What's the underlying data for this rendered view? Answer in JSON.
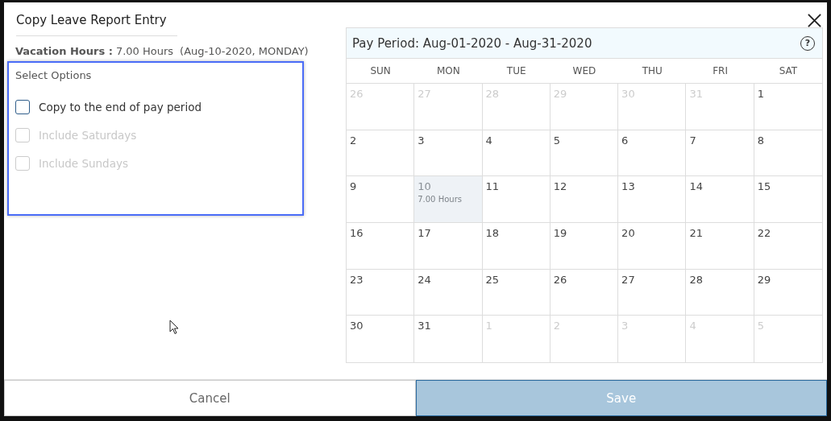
{
  "dialog": {
    "title": "Copy Leave Report Entry"
  },
  "entry": {
    "label": "Vacation Hours :",
    "hours": "7.00 Hours",
    "date": "(Aug-10-2020, MONDAY)"
  },
  "options": {
    "heading": "Select Options",
    "focused": true,
    "items": [
      {
        "label": "Copy to the end of pay period",
        "checked": false,
        "disabled": false
      },
      {
        "label": "Include Saturdays",
        "checked": false,
        "disabled": true
      },
      {
        "label": "Include Sundays",
        "checked": false,
        "disabled": true
      }
    ]
  },
  "calendar": {
    "title": "Pay Period: Aug-01-2020 - Aug-31-2020",
    "help": "?",
    "weekdays": [
      "SUN",
      "MON",
      "TUE",
      "WED",
      "THU",
      "FRI",
      "SAT"
    ],
    "days": [
      {
        "day": "26",
        "outside": true,
        "selected": false
      },
      {
        "day": "27",
        "outside": true,
        "selected": false
      },
      {
        "day": "28",
        "outside": true,
        "selected": false
      },
      {
        "day": "29",
        "outside": true,
        "selected": false
      },
      {
        "day": "30",
        "outside": true,
        "selected": false
      },
      {
        "day": "31",
        "outside": true,
        "selected": false
      },
      {
        "day": "1",
        "outside": false,
        "selected": false
      },
      {
        "day": "2",
        "outside": false,
        "selected": false
      },
      {
        "day": "3",
        "outside": false,
        "selected": false
      },
      {
        "day": "4",
        "outside": false,
        "selected": false
      },
      {
        "day": "5",
        "outside": false,
        "selected": false
      },
      {
        "day": "6",
        "outside": false,
        "selected": false
      },
      {
        "day": "7",
        "outside": false,
        "selected": false
      },
      {
        "day": "8",
        "outside": false,
        "selected": false
      },
      {
        "day": "9",
        "outside": false,
        "selected": false
      },
      {
        "day": "10",
        "outside": false,
        "selected": true,
        "note": "7.00 Hours"
      },
      {
        "day": "11",
        "outside": false,
        "selected": false
      },
      {
        "day": "12",
        "outside": false,
        "selected": false
      },
      {
        "day": "13",
        "outside": false,
        "selected": false
      },
      {
        "day": "14",
        "outside": false,
        "selected": false
      },
      {
        "day": "15",
        "outside": false,
        "selected": false
      },
      {
        "day": "16",
        "outside": false,
        "selected": false
      },
      {
        "day": "17",
        "outside": false,
        "selected": false
      },
      {
        "day": "18",
        "outside": false,
        "selected": false
      },
      {
        "day": "19",
        "outside": false,
        "selected": false
      },
      {
        "day": "20",
        "outside": false,
        "selected": false
      },
      {
        "day": "21",
        "outside": false,
        "selected": false
      },
      {
        "day": "22",
        "outside": false,
        "selected": false
      },
      {
        "day": "23",
        "outside": false,
        "selected": false
      },
      {
        "day": "24",
        "outside": false,
        "selected": false
      },
      {
        "day": "25",
        "outside": false,
        "selected": false
      },
      {
        "day": "26",
        "outside": false,
        "selected": false
      },
      {
        "day": "27",
        "outside": false,
        "selected": false
      },
      {
        "day": "28",
        "outside": false,
        "selected": false
      },
      {
        "day": "29",
        "outside": false,
        "selected": false
      },
      {
        "day": "30",
        "outside": false,
        "selected": false
      },
      {
        "day": "31",
        "outside": false,
        "selected": false
      },
      {
        "day": "1",
        "outside": true,
        "selected": false
      },
      {
        "day": "2",
        "outside": true,
        "selected": false
      },
      {
        "day": "3",
        "outside": true,
        "selected": false
      },
      {
        "day": "4",
        "outside": true,
        "selected": false
      },
      {
        "day": "5",
        "outside": true,
        "selected": false
      }
    ]
  },
  "buttons": [
    {
      "label": "Cancel",
      "kind": "secondary",
      "disabled": false
    },
    {
      "label": "Save",
      "kind": "primary",
      "disabled": true
    }
  ]
}
